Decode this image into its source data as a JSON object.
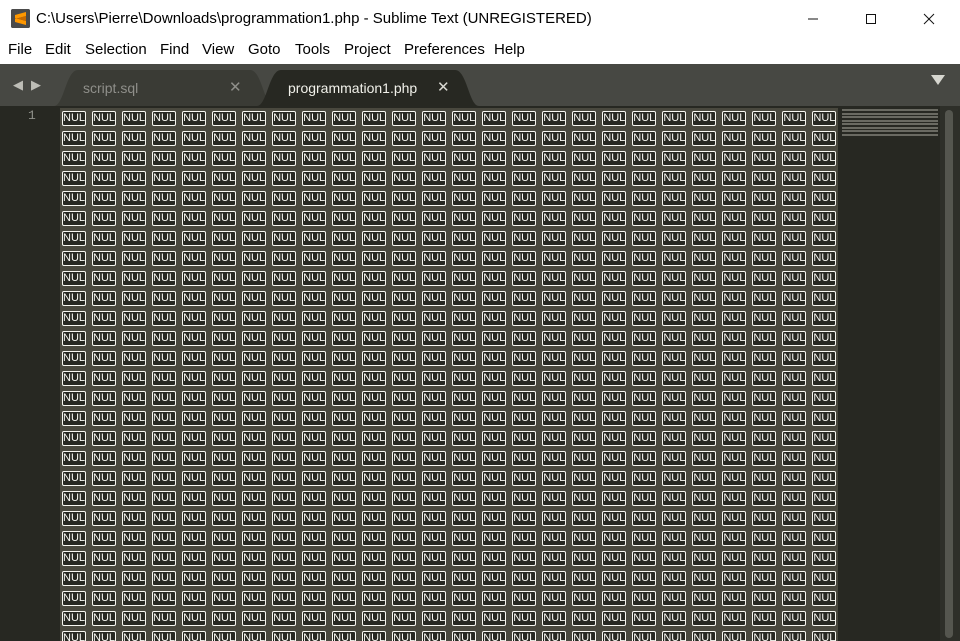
{
  "window": {
    "title": "C:\\Users\\Pierre\\Downloads\\programmation1.php - Sublime Text (UNREGISTERED)",
    "app_icon": "sublime-text-icon",
    "controls": {
      "minimize": "—",
      "maximize": "☐",
      "close": "✕"
    }
  },
  "menu": {
    "items": [
      "File",
      "Edit",
      "Selection",
      "Find",
      "View",
      "Goto",
      "Tools",
      "Project",
      "Preferences",
      "Help"
    ]
  },
  "tabs": [
    {
      "label": "script.sql",
      "active": false
    },
    {
      "label": "programmation1.php",
      "active": true
    }
  ],
  "tab_close_glyph": "✕",
  "nav": {
    "back": "◀",
    "forward": "▶"
  },
  "editor": {
    "line_number": "1",
    "nul_token": "NUL",
    "colors": {
      "background": "#272822",
      "selection": "#49483e",
      "tab_bar": "#474843",
      "active_tab": "#272822",
      "inactive_tab": "#3a3b35"
    }
  }
}
